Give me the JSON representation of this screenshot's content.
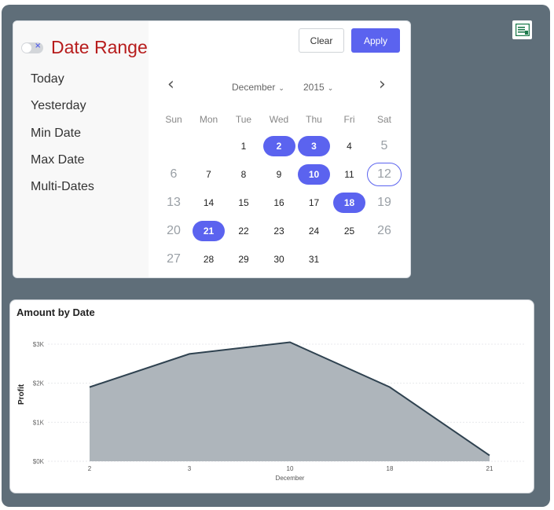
{
  "picker": {
    "title": "Date Range",
    "presets": [
      "Today",
      "Yesterday",
      "Min Date",
      "Max Date",
      "Multi-Dates"
    ],
    "clear_label": "Clear",
    "apply_label": "Apply",
    "month": "December",
    "year": "2015",
    "weekdays": [
      "Sun",
      "Mon",
      "Tue",
      "Wed",
      "Thu",
      "Fri",
      "Sat"
    ],
    "weeks": [
      [
        "",
        "",
        "1",
        "2",
        "3",
        "4",
        "5"
      ],
      [
        "6",
        "7",
        "8",
        "9",
        "10",
        "11",
        "12"
      ],
      [
        "13",
        "14",
        "15",
        "16",
        "17",
        "18",
        "19"
      ],
      [
        "20",
        "21",
        "22",
        "23",
        "24",
        "25",
        "26"
      ],
      [
        "27",
        "28",
        "29",
        "30",
        "31",
        "",
        ""
      ]
    ],
    "selected_days": [
      "2",
      "3",
      "10",
      "18",
      "21"
    ],
    "today_day": "12",
    "accent_color": "#5b63ef",
    "title_color": "#b71c1c"
  },
  "chart": {
    "title": "Amount by Date"
  },
  "chart_data": {
    "type": "area",
    "title": "Amount by Date",
    "xlabel": "December",
    "ylabel": "Profit",
    "categories": [
      "2",
      "3",
      "10",
      "18",
      "21"
    ],
    "values": [
      1900,
      2750,
      3050,
      1900,
      150
    ],
    "y_ticks": [
      "$0K",
      "$1K",
      "$2K",
      "$3K"
    ],
    "ylim": [
      0,
      3000
    ],
    "fill_color": "#aeb5bb",
    "line_color": "#2f4250",
    "grid": true
  },
  "icons": {
    "export": "excel-export-icon"
  }
}
